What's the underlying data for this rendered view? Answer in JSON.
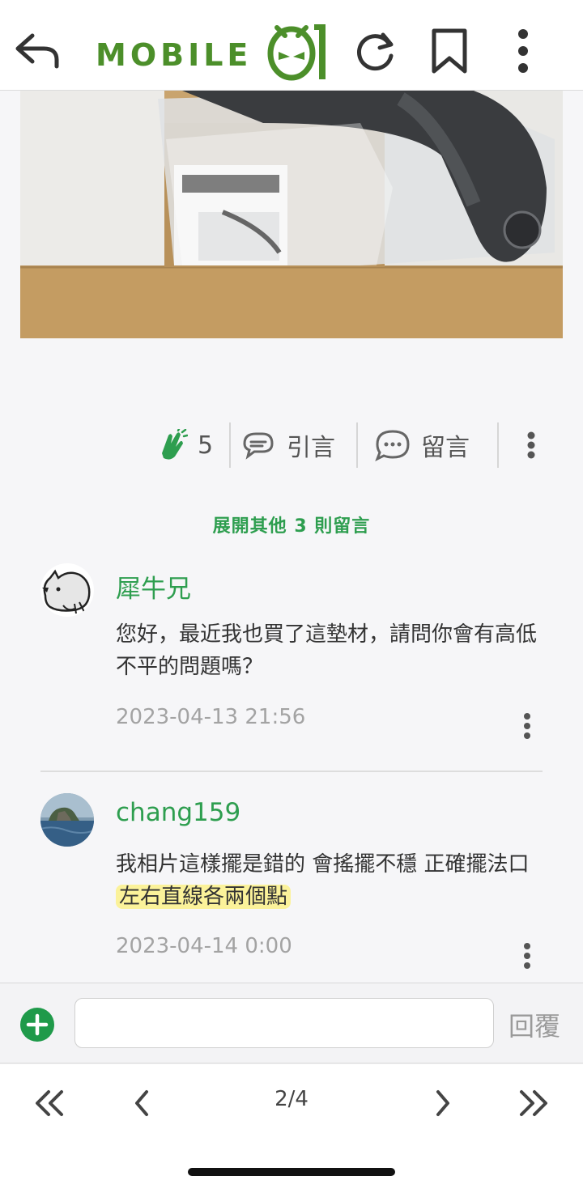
{
  "header": {
    "logo_text": "MOBILE",
    "icons": [
      "back-icon",
      "refresh-icon",
      "bookmark-icon",
      "more-vertical-icon"
    ]
  },
  "actions": {
    "clap_count": "5",
    "quote_label": "引言",
    "comment_label": "留言"
  },
  "expand_label": "展開其他 3 則留言",
  "comments": [
    {
      "author": "犀牛兄",
      "body": "您好，最近我也買了這墊材，請問你會有高低不平的問題嗎？",
      "time": "2023-04-13 21:56"
    },
    {
      "author": "chang159",
      "body_plain": "我相片這樣擺是錯的 會搖擺不穩 正確擺法口",
      "body_highlight": "左右直線各兩個點",
      "time": "2023-04-14 0:00"
    }
  ],
  "reply": {
    "input_value": "",
    "button_label": "回覆"
  },
  "pager": {
    "page_label": "2/4"
  },
  "colors": {
    "accent_green": "#2e9e4f",
    "logo_green": "#4c8f2a",
    "highlight": "#fbf29a"
  }
}
